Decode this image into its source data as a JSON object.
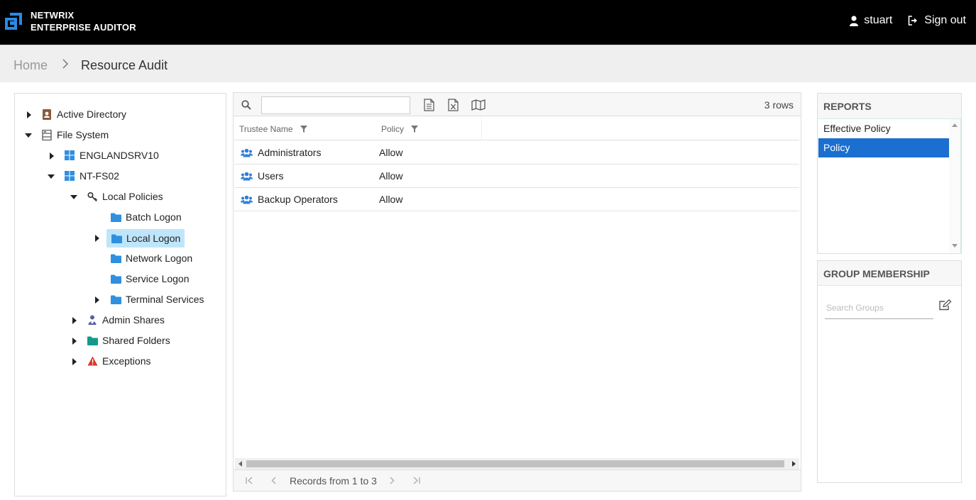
{
  "header": {
    "brand_line1": "NETWRIX",
    "brand_line2": "ENTERPRISE AUDITOR",
    "user_name": "stuart",
    "signout_label": "Sign out"
  },
  "breadcrumb": {
    "home": "Home",
    "current": "Resource Audit"
  },
  "tree": {
    "active_directory": "Active Directory",
    "file_system": "File System",
    "englandsrv10": "ENGLANDSRV10",
    "nt_fs02": "NT-FS02",
    "local_policies": "Local Policies",
    "batch_logon": "Batch Logon",
    "local_logon": "Local Logon",
    "network_logon": "Network Logon",
    "service_logon": "Service Logon",
    "terminal_services": "Terminal Services",
    "admin_shares": "Admin Shares",
    "shared_folders": "Shared Folders",
    "exceptions": "Exceptions"
  },
  "grid": {
    "search_value": "",
    "row_count": "3 rows",
    "columns": [
      "Trustee Name",
      "Policy"
    ],
    "rows": [
      {
        "name": "Administrators",
        "policy": "Allow"
      },
      {
        "name": "Users",
        "policy": "Allow"
      },
      {
        "name": "Backup Operators",
        "policy": "Allow"
      }
    ],
    "pager_text": "Records from 1 to 3"
  },
  "reports": {
    "title": "REPORTS",
    "items": [
      "Effective Policy",
      "Policy"
    ],
    "selected": "Policy"
  },
  "group_membership": {
    "title": "GROUP MEMBERSHIP",
    "search_placeholder": "Search Groups"
  },
  "colors": {
    "topbar": "#000000",
    "accent_blue": "#1a6fd0",
    "selected_tree": "#bfe5fb",
    "folder_blue": "#2f8fe0",
    "warning_red": "#d9342b",
    "teal_folder": "#139a8a"
  }
}
